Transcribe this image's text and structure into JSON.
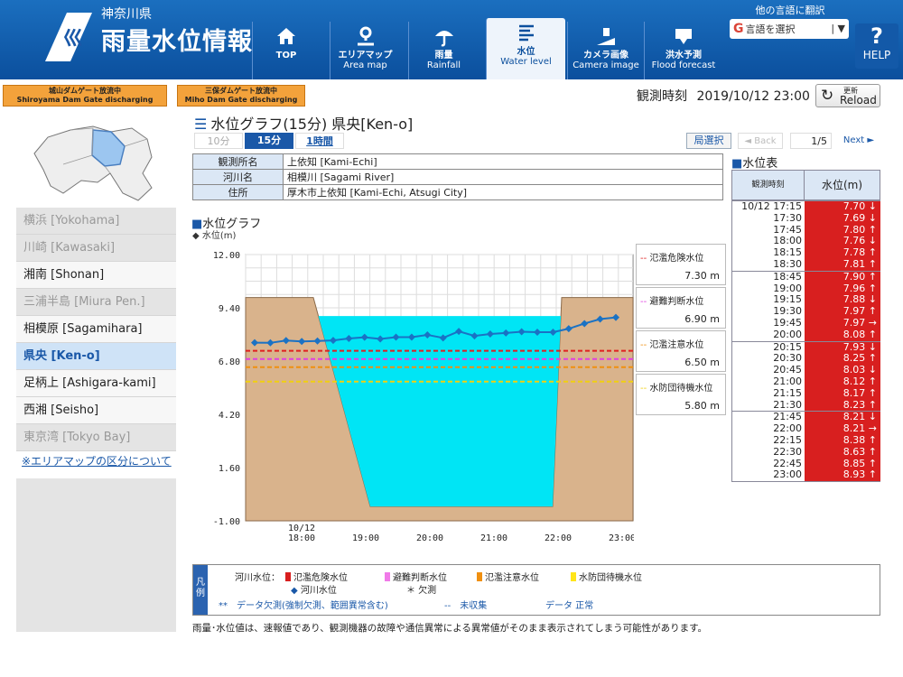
{
  "header": {
    "prefecture": "神奈川県",
    "app_title": "雨量水位情報",
    "nav": [
      {
        "l1": "TOP",
        "l2": "",
        "icon": "home-icon"
      },
      {
        "l1": "エリアマップ",
        "l2": "Area map",
        "icon": "map-pin-icon"
      },
      {
        "l1": "雨量",
        "l2": "Rainfall",
        "icon": "umbrella-icon"
      },
      {
        "l1": "水位",
        "l2": "Water level",
        "icon": "water-level-icon"
      },
      {
        "l1": "カメラ画像",
        "l2": "Camera image",
        "icon": "camera-icon"
      },
      {
        "l1": "洪水予測",
        "l2": "Flood forecast",
        "icon": "flood-icon"
      }
    ],
    "lang_label": "他の言語に翻訳",
    "lang_select": "言語を選択",
    "help": "HELP"
  },
  "dam_notices": [
    {
      "line1": "城山ダムゲート放流中",
      "line2": "Shiroyama Dam Gate discharging"
    },
    {
      "line1": "三保ダムゲート放流中",
      "line2": "Miho Dam Gate discharging"
    }
  ],
  "observation": {
    "label": "観測時刻",
    "time": "2019/10/12 23:00"
  },
  "reload": {
    "line1": "更新",
    "line2": "Reload"
  },
  "sidebar": {
    "areas": [
      {
        "label": "横浜 [Yokohama]",
        "state": "disabled"
      },
      {
        "label": "川崎 [Kawasaki]",
        "state": "disabled"
      },
      {
        "label": "湘南 [Shonan]",
        "state": "enabled"
      },
      {
        "label": "三浦半島 [Miura Pen.]",
        "state": "disabled"
      },
      {
        "label": "相模原 [Sagamihara]",
        "state": "enabled"
      },
      {
        "label": "県央 [Ken-o]",
        "state": "selected"
      },
      {
        "label": "足柄上 [Ashigara-kami]",
        "state": "enabled"
      },
      {
        "label": "西湘 [Seisho]",
        "state": "enabled"
      },
      {
        "label": "東京湾 [Tokyo Bay]",
        "state": "disabled"
      }
    ],
    "area_link": "※エリアマップの区分について"
  },
  "page": {
    "title": "水位グラフ(15分) 県央[Ken-o]",
    "intervals": [
      "10分",
      "15分",
      "1時間"
    ],
    "station_select": "局選択",
    "back": "◄ Back",
    "page_num": "1/5",
    "next": "Next ►"
  },
  "station": [
    {
      "key": "観測所名",
      "value": "上依知 [Kami-Echi]"
    },
    {
      "key": "河川名",
      "value": "相模川 [Sagami River]"
    },
    {
      "key": "住所",
      "value": "厚木市上依知 [Kami-Echi, Atsugi City]"
    }
  ],
  "graph": {
    "label": "水位グラフ",
    "series_label": "◆ 水位(m)"
  },
  "thresholds": [
    {
      "name": "氾濫危険水位",
      "value": "7.30 m",
      "color": "#e02020"
    },
    {
      "name": "避難判断水位",
      "value": "6.90 m",
      "color": "#e040e0"
    },
    {
      "name": "氾濫注意水位",
      "value": "6.50 m",
      "color": "#f09010"
    },
    {
      "name": "水防団待機水位",
      "value": "5.80 m",
      "color": "#f0d010"
    }
  ],
  "chart_data": {
    "type": "line",
    "series": [
      {
        "name": "水位(m)",
        "values": [
          7.7,
          7.69,
          7.8,
          7.76,
          7.78,
          7.81,
          7.9,
          7.96,
          7.88,
          7.97,
          7.97,
          8.08,
          7.93,
          8.25,
          8.03,
          8.12,
          8.17,
          8.23,
          8.21,
          8.21,
          8.38,
          8.63,
          8.85,
          8.93
        ]
      }
    ],
    "x": [
      "17:15",
      "17:30",
      "17:45",
      "18:00",
      "18:15",
      "18:30",
      "18:45",
      "19:00",
      "19:15",
      "19:30",
      "19:45",
      "20:00",
      "20:15",
      "20:30",
      "20:45",
      "21:00",
      "21:15",
      "21:30",
      "21:45",
      "22:00",
      "22:15",
      "22:30",
      "22:45",
      "23:00"
    ],
    "x_ticks": [
      "10/12\n18:00",
      "19:00",
      "20:00",
      "21:00",
      "22:00",
      "23:00"
    ],
    "y_ticks": [
      "12.00",
      "9.40",
      "6.80",
      "4.20",
      "1.60",
      "-1.00"
    ],
    "ylim": [
      -1.0,
      12.0
    ],
    "threshold_values": [
      7.3,
      6.9,
      6.5,
      5.8
    ],
    "channel": {
      "bank_top": 9.9,
      "water_surface": 9.0,
      "bed": -0.3
    },
    "colors": {
      "bank": "#d9b38c",
      "water": "#00e5f5",
      "line": "#1a72c4"
    }
  },
  "wl_table": {
    "title": "水位表",
    "head_time": "観測時刻",
    "head_level": "水位(m)",
    "groups": [
      [
        {
          "t": "10/12 17:15",
          "v": "7.70 ↓"
        },
        {
          "t": "17:30",
          "v": "7.69 ↓"
        },
        {
          "t": "17:45",
          "v": "7.80 ↑"
        },
        {
          "t": "18:00",
          "v": "7.76 ↓"
        },
        {
          "t": "18:15",
          "v": "7.78 ↑"
        },
        {
          "t": "18:30",
          "v": "7.81 ↑"
        }
      ],
      [
        {
          "t": "18:45",
          "v": "7.90 ↑"
        },
        {
          "t": "19:00",
          "v": "7.96 ↑"
        },
        {
          "t": "19:15",
          "v": "7.88 ↓"
        },
        {
          "t": "19:30",
          "v": "7.97 ↑"
        },
        {
          "t": "19:45",
          "v": "7.97 →"
        },
        {
          "t": "20:00",
          "v": "8.08 ↑"
        }
      ],
      [
        {
          "t": "20:15",
          "v": "7.93 ↓"
        },
        {
          "t": "20:30",
          "v": "8.25 ↑"
        },
        {
          "t": "20:45",
          "v": "8.03 ↓"
        },
        {
          "t": "21:00",
          "v": "8.12 ↑"
        },
        {
          "t": "21:15",
          "v": "8.17 ↑"
        },
        {
          "t": "21:30",
          "v": "8.23 ↑"
        }
      ],
      [
        {
          "t": "21:45",
          "v": "8.21 ↓"
        },
        {
          "t": "22:00",
          "v": "8.21 →"
        },
        {
          "t": "22:15",
          "v": "8.38 ↑"
        },
        {
          "t": "22:30",
          "v": "8.63 ↑"
        },
        {
          "t": "22:45",
          "v": "8.85 ↑"
        },
        {
          "t": "23:00",
          "v": "8.93 ↑"
        }
      ]
    ]
  },
  "legend": {
    "tag": "凡例",
    "river_label": "河川水位：",
    "items": [
      {
        "label": "氾濫危険水位",
        "color": "#d81f1f"
      },
      {
        "label": "避難判断水位",
        "color": "#f07ae8"
      },
      {
        "label": "氾濫注意水位",
        "color": "#f09010"
      },
      {
        "label": "水防団待機水位",
        "color": "#ffe51a"
      }
    ],
    "level_item": "河川水位",
    "missing": "＊ 欠測",
    "row3a": "**　データ欠測(強制欠測、範囲異常含む)",
    "row3b": "--　未収集",
    "row3c": "データ 正常"
  },
  "disclaimer": "雨量･水位値は、速報値であり、観測機器の故障や通信異常による異常値がそのまま表示されてしまう可能性があります。"
}
